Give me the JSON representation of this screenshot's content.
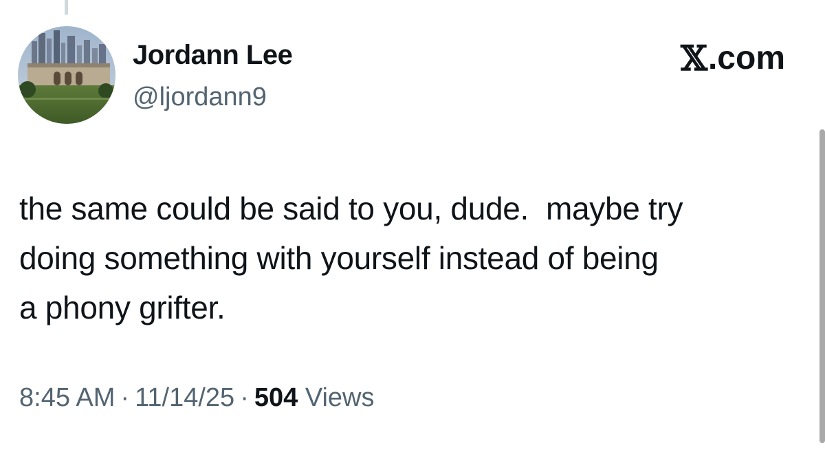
{
  "author": {
    "display_name": "Jordann Lee",
    "handle": "@ljordann9",
    "avatar_description": "city-skyline-avatar"
  },
  "brand": {
    "logo_glyph": "𝕏",
    "domain_suffix": ".com"
  },
  "tweet": {
    "text": "the same could be said to you, dude.  maybe try\ndoing something with yourself instead of being\na phony grifter."
  },
  "meta": {
    "time": "8:45 AM",
    "separator": "·",
    "date": "11/14/25",
    "views_count": "504",
    "views_label": "Views"
  },
  "colors": {
    "text_primary": "#0f1419",
    "text_secondary": "#536471",
    "thread_line": "#cfd9de"
  }
}
